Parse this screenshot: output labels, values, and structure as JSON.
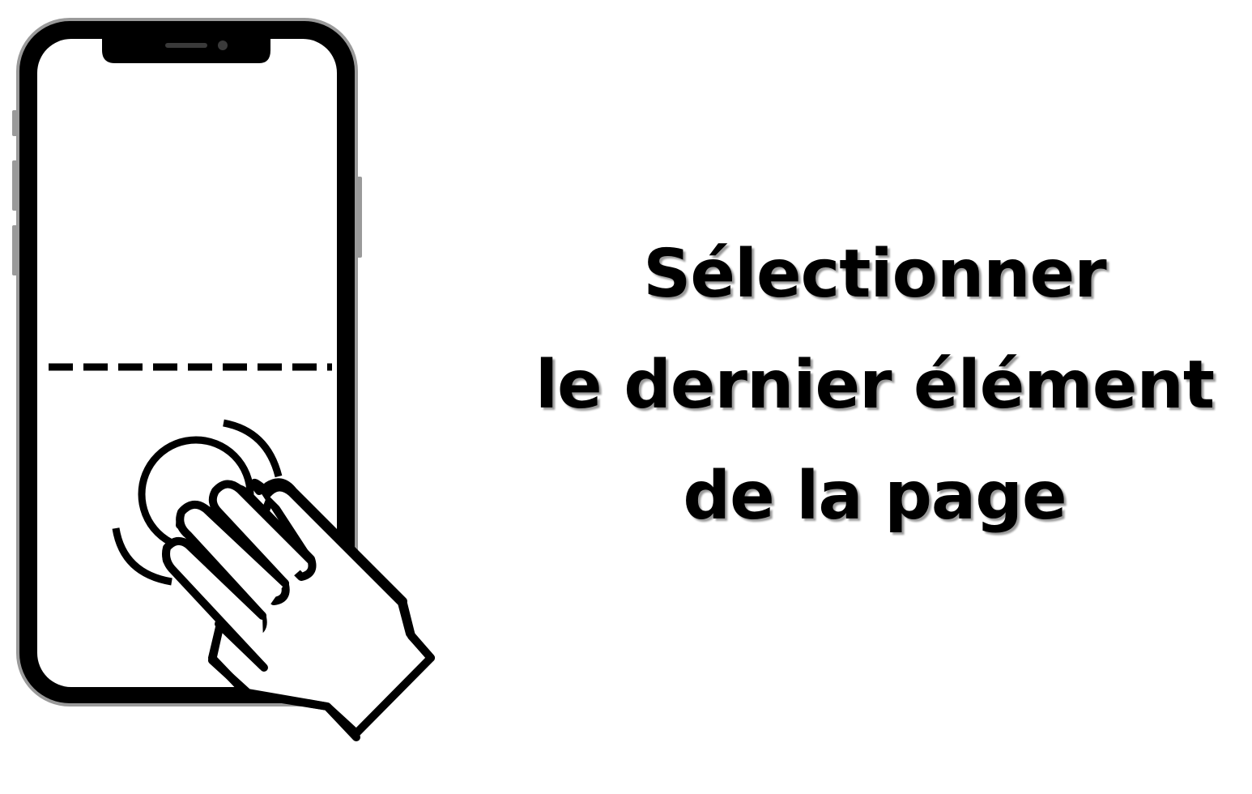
{
  "caption": {
    "line1": "Sélectionner",
    "line2": "le dernier élément",
    "line3": "de la page"
  },
  "icons": {
    "phone": "smartphone-icon",
    "hand": "three-finger-tap-hand-icon",
    "divider": "dashed-divider-line",
    "tap": "tap-ripple-icon"
  },
  "colors": {
    "stroke": "#000000",
    "phone_frame": "#9a9a9a",
    "shadow": "#9a9a9a",
    "background": "#ffffff"
  }
}
